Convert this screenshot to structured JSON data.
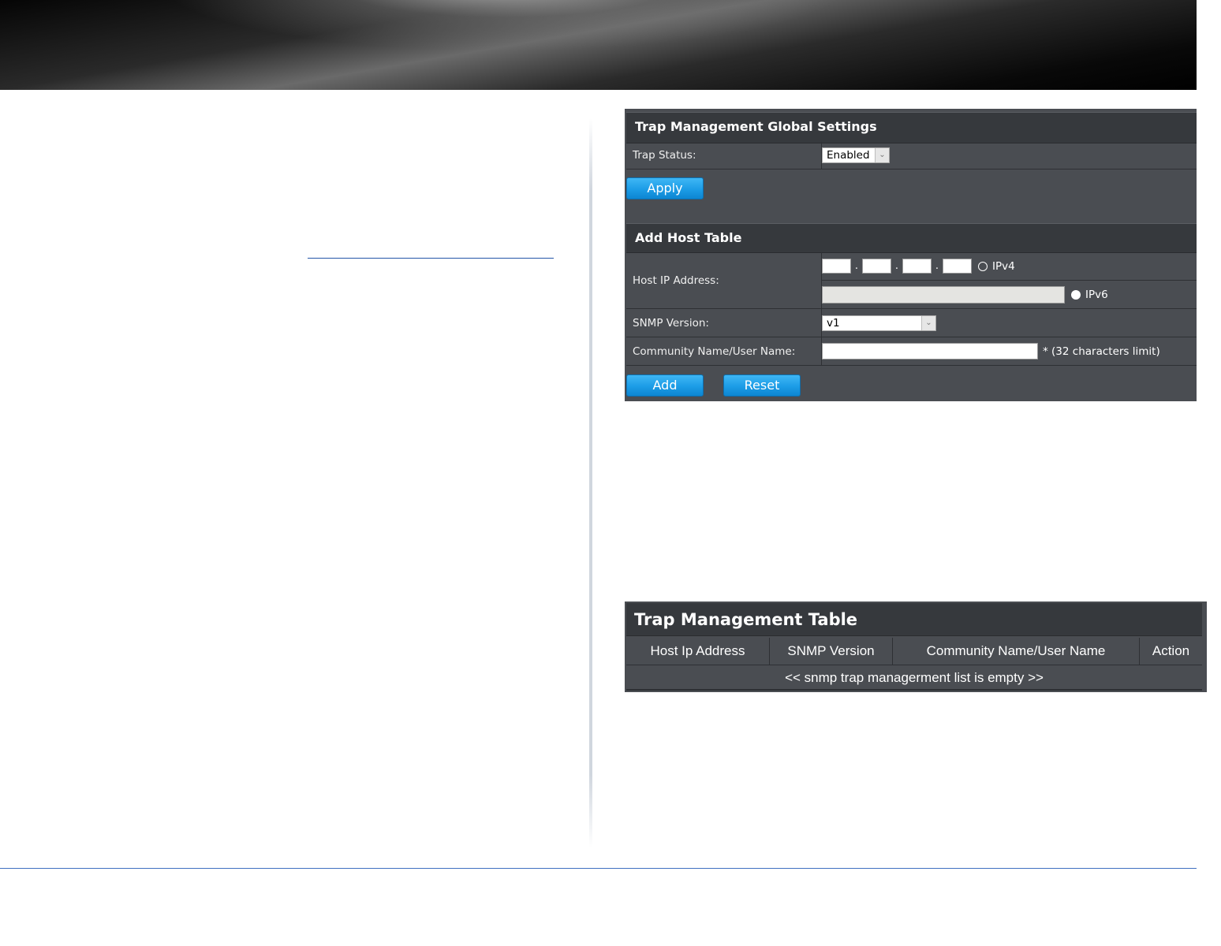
{
  "global_settings": {
    "title": "Trap Management Global Settings",
    "trap_status_label": "Trap Status:",
    "trap_status_value": "Enabled",
    "apply_label": "Apply"
  },
  "add_host": {
    "title": "Add Host Table",
    "host_ip_label": "Host IP Address:",
    "ipv4_label": "IPv4",
    "ipv6_label": "IPv6",
    "ip_separator": ".",
    "snmp_version_label": "SNMP Version:",
    "snmp_version_value": "v1",
    "community_label": "Community Name/User Name:",
    "community_note": "* (32 characters limit)",
    "add_label": "Add",
    "reset_label": "Reset"
  },
  "trap_table": {
    "title": "Trap Management Table",
    "columns": [
      "Host Ip Address",
      "SNMP Version",
      "Community Name/User Name",
      "Action"
    ],
    "empty_message": "<< snmp trap managerment list is empty >>"
  }
}
